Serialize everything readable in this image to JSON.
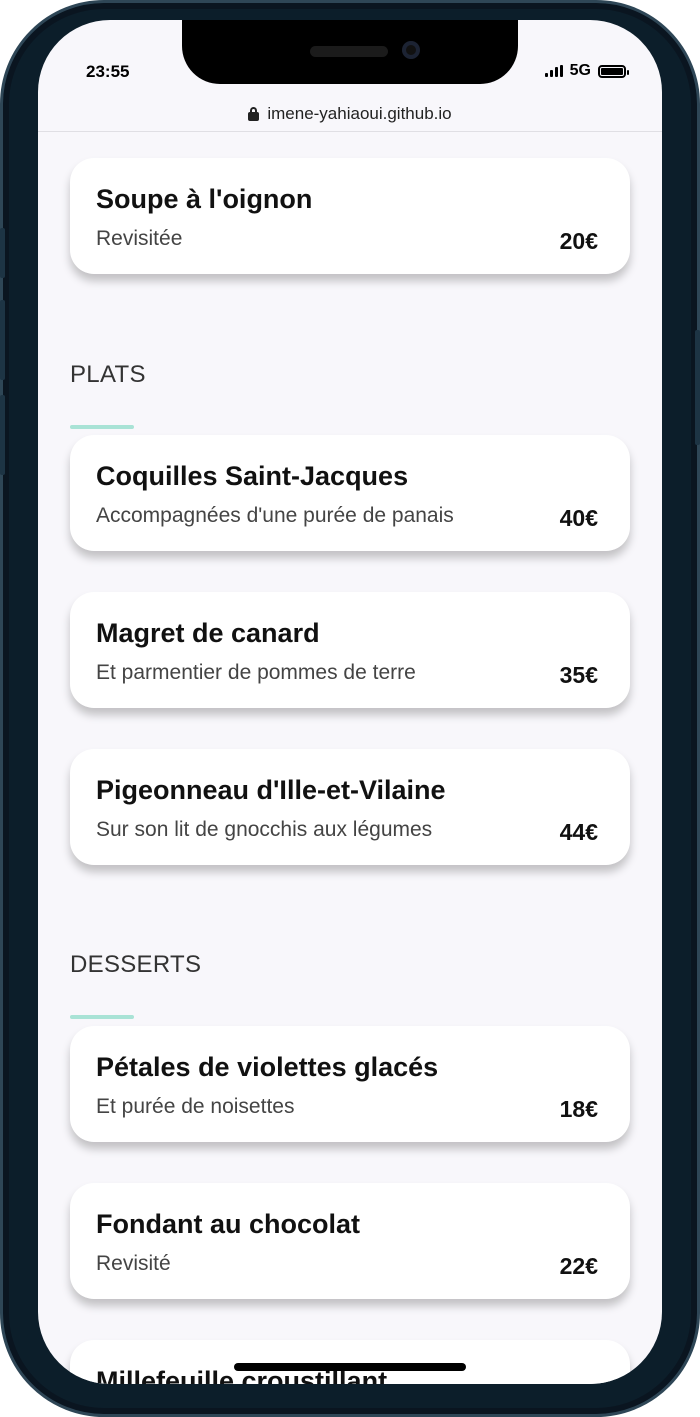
{
  "status_bar": {
    "time": "23:55",
    "network": "5G"
  },
  "browser": {
    "url": "imene-yahiaoui.github.io"
  },
  "menu": {
    "top_card": {
      "name": "Soupe à l'oignon",
      "description": "Revisitée",
      "price": "20€"
    },
    "plats": {
      "title": "PLATS",
      "items": [
        {
          "name": "Coquilles Saint-Jacques",
          "description": "Accompagnées d'une purée de panais",
          "price": "40€"
        },
        {
          "name": "Magret de canard",
          "description": "Et parmentier de pommes de terre",
          "price": "35€"
        },
        {
          "name": "Pigeonneau d'Ille-et-Vilaine",
          "description": "Sur son lit de gnocchis aux légumes",
          "price": "44€"
        }
      ]
    },
    "desserts": {
      "title": "DESSERTS",
      "items": [
        {
          "name": "Pétales de violettes glacés",
          "description": "Et purée de noisettes",
          "price": "18€"
        },
        {
          "name": "Fondant au chocolat",
          "description": "Revisité",
          "price": "22€"
        },
        {
          "name": "Millefeuille croustillant"
        }
      ]
    }
  },
  "colors": {
    "accent": "#a9e3d6",
    "background": "#f8f7fb",
    "card": "#ffffff",
    "frame": "#0c1e2a"
  }
}
